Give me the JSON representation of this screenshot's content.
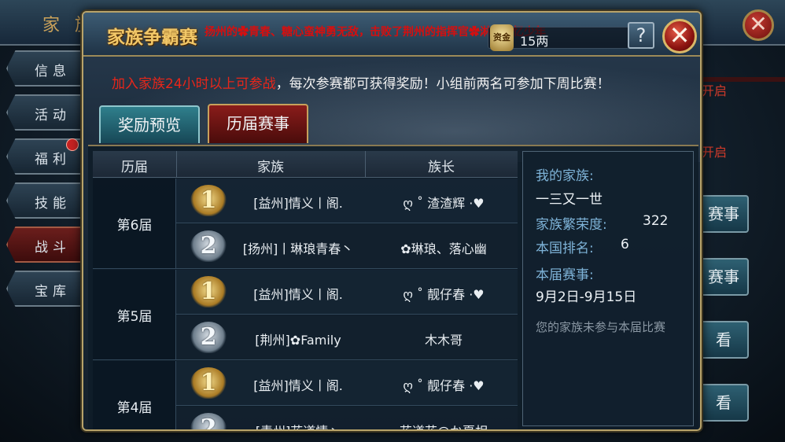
{
  "background": {
    "window_title": "家 族",
    "nav": [
      {
        "label": "信息"
      },
      {
        "label": "活动"
      },
      {
        "label": "福利"
      },
      {
        "label": "技能"
      },
      {
        "label": "战斗"
      },
      {
        "label": "宝库"
      }
    ],
    "right_red_1": "开启",
    "right_red_2": "开启",
    "right_buttons": [
      "赛事",
      "赛事",
      "看",
      "看"
    ],
    "close_symbol": "✕"
  },
  "dialog": {
    "title": "家族争霸赛",
    "ticker": "扬州的✿青春、糖心蛮神勇无敌，击败了荆州的指挥官✿淋雨丶忆少年",
    "currency": {
      "icon_label": "资金",
      "value": "15两"
    },
    "help_symbol": "?",
    "close_symbol": "✕",
    "notice_red": "加入家族24小时以上可参战",
    "notice_rest": "，每次参赛都可获得奖励！小组前两名可参加下周比赛！",
    "tabs": [
      {
        "label": "奖励预览",
        "active": false
      },
      {
        "label": "历届赛事",
        "active": true
      }
    ]
  },
  "history": {
    "headers": {
      "season": "历届",
      "family": "家族",
      "leader": "族长"
    },
    "seasons": [
      {
        "label": "第6届",
        "entries": [
          {
            "rank": "1",
            "family": "[益州]情义丨阁.",
            "leader": "ღ ˚ 渣渣辉 ·♥"
          },
          {
            "rank": "2",
            "family": "[扬州]丨琳琅青春丶",
            "leader": "✿琳琅、落心幽"
          }
        ]
      },
      {
        "label": "第5届",
        "entries": [
          {
            "rank": "1",
            "family": "[益州]情义丨阁.",
            "leader": "ღ ˚ 靓仔春 ·♥"
          },
          {
            "rank": "2",
            "family": "[荆州]✿Family",
            "leader": "木木哥"
          }
        ]
      },
      {
        "label": "第4届",
        "entries": [
          {
            "rank": "1",
            "family": "[益州]情义丨阁.",
            "leader": "ღ ˚ 靓仔春 ·♥"
          },
          {
            "rank": "2",
            "family": "[青州]花道情丶",
            "leader": "花道花@か夏相"
          }
        ]
      }
    ]
  },
  "my_family": {
    "label": "我的家族:",
    "name": "一三又一世",
    "prosperity_label": "家族繁荣度:",
    "prosperity_value": "322",
    "rank_label": "本国排名:",
    "rank_value": "6",
    "season_label": "本届赛事:",
    "season_dates": "9月2日-9月15日",
    "status": "您的家族未参与本届比赛"
  },
  "colors": {
    "accent_gold": "#f2c868",
    "notice_red": "#e8261a",
    "label_blue": "#7eb3d8",
    "tab_active": "#8a1c1a",
    "tab_inactive": "#2f7f8c"
  }
}
